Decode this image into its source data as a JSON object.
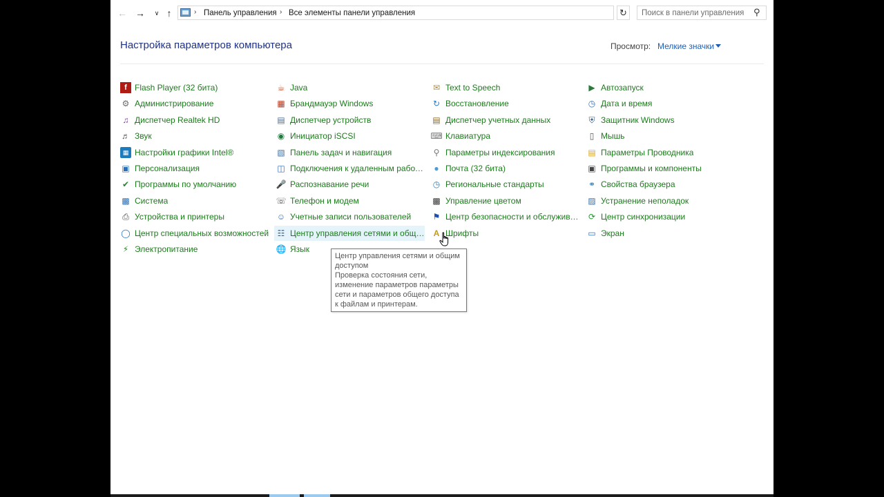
{
  "navigation": {
    "back_icon": "arrow-left-icon",
    "forward_icon": "arrow-right-icon",
    "recent_icon": "chevron-down-icon",
    "up_icon": "arrow-up-icon"
  },
  "address_bar": {
    "icon": "control-panel-icon",
    "breadcrumbs": [
      "Панель управления",
      "Все элементы панели управления"
    ],
    "dropdown_icon": "chevron-down-icon",
    "refresh_icon": "refresh-icon"
  },
  "search": {
    "placeholder": "Поиск в панели управления",
    "value": "",
    "icon": "search-icon"
  },
  "header": {
    "title": "Настройка параметров компьютера",
    "view_label": "Просмотр:",
    "view_value": "Мелкие значки"
  },
  "columns": [
    [
      {
        "label": "Flash Player (32 бита)",
        "icon": "flash-player-icon"
      },
      {
        "label": "Администрирование",
        "icon": "administrative-tools-icon"
      },
      {
        "label": "Диспетчер Realtek HD",
        "icon": "realtek-audio-icon"
      },
      {
        "label": "Звук",
        "icon": "sound-icon"
      },
      {
        "label": "Настройки графики Intel®",
        "icon": "intel-graphics-icon"
      },
      {
        "label": "Персонализация",
        "icon": "personalization-icon"
      },
      {
        "label": "Программы по умолчанию",
        "icon": "default-programs-icon"
      },
      {
        "label": "Система",
        "icon": "system-icon"
      },
      {
        "label": "Устройства и принтеры",
        "icon": "devices-printers-icon"
      },
      {
        "label": "Центр специальных возможностей",
        "icon": "ease-of-access-icon"
      },
      {
        "label": "Электропитание",
        "icon": "power-options-icon"
      }
    ],
    [
      {
        "label": "Java",
        "icon": "java-icon"
      },
      {
        "label": "Брандмауэр Windows",
        "icon": "firewall-icon"
      },
      {
        "label": "Диспетчер устройств",
        "icon": "device-manager-icon"
      },
      {
        "label": "Инициатор iSCSI",
        "icon": "iscsi-icon"
      },
      {
        "label": "Панель задач и навигация",
        "icon": "taskbar-icon"
      },
      {
        "label": "Подключения к удаленным рабоч...",
        "icon": "remote-desktop-icon"
      },
      {
        "label": "Распознавание речи",
        "icon": "microphone-icon"
      },
      {
        "label": "Телефон и модем",
        "icon": "phone-modem-icon"
      },
      {
        "label": "Учетные записи пользователей",
        "icon": "user-accounts-icon"
      },
      {
        "label": "Центр управления сетями и общи...",
        "icon": "network-center-icon"
      },
      {
        "label": "Язык",
        "icon": "language-icon"
      }
    ],
    [
      {
        "label": "Text to Speech",
        "icon": "text-to-speech-icon"
      },
      {
        "label": "Восстановление",
        "icon": "recovery-icon"
      },
      {
        "label": "Диспетчер учетных данных",
        "icon": "credential-manager-icon"
      },
      {
        "label": "Клавиатура",
        "icon": "keyboard-icon"
      },
      {
        "label": "Параметры индексирования",
        "icon": "indexing-icon"
      },
      {
        "label": "Почта (32 бита)",
        "icon": "mail-icon"
      },
      {
        "label": "Региональные стандарты",
        "icon": "region-icon"
      },
      {
        "label": "Управление цветом",
        "icon": "color-management-icon"
      },
      {
        "label": "Центр безопасности и обслуживан...",
        "icon": "security-flag-icon"
      },
      {
        "label": "Шрифты",
        "icon": "fonts-icon"
      }
    ],
    [
      {
        "label": "Автозапуск",
        "icon": "autoplay-icon"
      },
      {
        "label": "Дата и время",
        "icon": "date-time-icon"
      },
      {
        "label": "Защитник Windows",
        "icon": "defender-icon"
      },
      {
        "label": "Мышь",
        "icon": "mouse-icon"
      },
      {
        "label": "Параметры Проводника",
        "icon": "explorer-options-icon"
      },
      {
        "label": "Программы и компоненты",
        "icon": "programs-features-icon"
      },
      {
        "label": "Свойства браузера",
        "icon": "internet-options-icon"
      },
      {
        "label": "Устранение неполадок",
        "icon": "troubleshooting-icon"
      },
      {
        "label": "Центр синхронизации",
        "icon": "sync-center-icon"
      },
      {
        "label": "Экран",
        "icon": "display-icon"
      }
    ]
  ],
  "tooltip": {
    "title": "Центр управления сетями и общим доступом",
    "description": "Проверка состояния сети, изменение параметров параметры сети и параметров общего доступа к файлам и принтерам."
  }
}
